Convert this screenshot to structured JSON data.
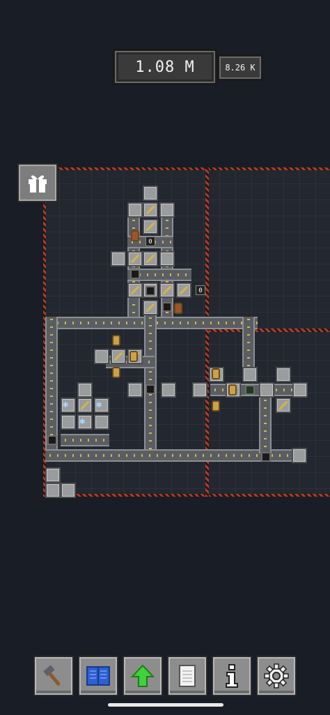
{
  "hud": {
    "money": "1.08 M",
    "rate": "8.26 K"
  },
  "map": {
    "counters": [
      "0",
      "0"
    ]
  },
  "toolbar": {
    "buttons": [
      {
        "name": "build-hammer-button",
        "icon": "hammer-icon"
      },
      {
        "name": "blueprint-book-button",
        "icon": "book-icon"
      },
      {
        "name": "upgrade-button",
        "icon": "green-up-arrow-icon"
      },
      {
        "name": "notes-button",
        "icon": "document-icon"
      },
      {
        "name": "info-button",
        "icon": "info-icon"
      },
      {
        "name": "settings-button",
        "icon": "gear-icon"
      }
    ]
  },
  "colors": {
    "background": "#181d26",
    "hazard": "#b23a2a",
    "belt": "#5a5d62",
    "upgrade_green": "#3fd23a",
    "blueprint_blue": "#2f5fd0"
  }
}
